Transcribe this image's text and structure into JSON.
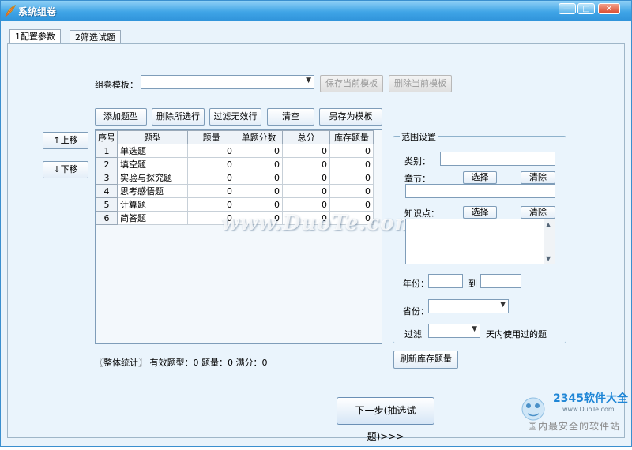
{
  "window": {
    "title": "系统组卷",
    "minimize": "—",
    "maximize": "□",
    "close": "✕"
  },
  "tabs": [
    {
      "label": "1配置参数"
    },
    {
      "label": "2筛选试题"
    }
  ],
  "template": {
    "label": "组卷模板：",
    "value": "",
    "save_button": "保存当前模板",
    "delete_button": "删除当前模板"
  },
  "toolbar": {
    "add": "添加题型",
    "delete_selected": "删除所选行",
    "filter_invalid": "过滤无效行",
    "clear": "清空",
    "save_as_template": "另存为模板"
  },
  "move": {
    "up": "↑上移",
    "down": "↓下移"
  },
  "grid": {
    "headers": [
      "序号",
      "题型",
      "题量",
      "单题分数",
      "总分",
      "库存题量"
    ],
    "rows": [
      [
        "1",
        "单选题",
        "0",
        "0",
        "0",
        "0"
      ],
      [
        "2",
        "填空题",
        "0",
        "0",
        "0",
        "0"
      ],
      [
        "3",
        "实验与探究题",
        "0",
        "0",
        "0",
        "0"
      ],
      [
        "4",
        "思考感悟题",
        "0",
        "0",
        "0",
        "0"
      ],
      [
        "5",
        "计算题",
        "0",
        "0",
        "0",
        "0"
      ],
      [
        "6",
        "简答题",
        "0",
        "0",
        "0",
        "0"
      ]
    ]
  },
  "stats": {
    "text": "〖整体统计〗 有效题型：0    题量：0    满分：0"
  },
  "range": {
    "title": "范围设置",
    "category_label": "类别：",
    "chapter_label": "章节：",
    "knowledge_label": "知识点：",
    "select": "选择",
    "clear": "清除",
    "year_label": "年份：",
    "to_label": "到",
    "province_label": "省份：",
    "filter_label": "过滤",
    "filter_suffix": "天内使用过的题"
  },
  "refresh_button": "刷新库存题量",
  "next_button": "下一步(抽选试题)>>>",
  "watermark": "www.DuoTe.com",
  "logo": {
    "brand": "2345软件大全",
    "site": "www.DuoTe.com",
    "slogan": "国内最安全的软件站"
  },
  "colors": {
    "titlebar": "#3fa4e6",
    "panel": "#eaf4fc",
    "border": "#7f9db9"
  }
}
